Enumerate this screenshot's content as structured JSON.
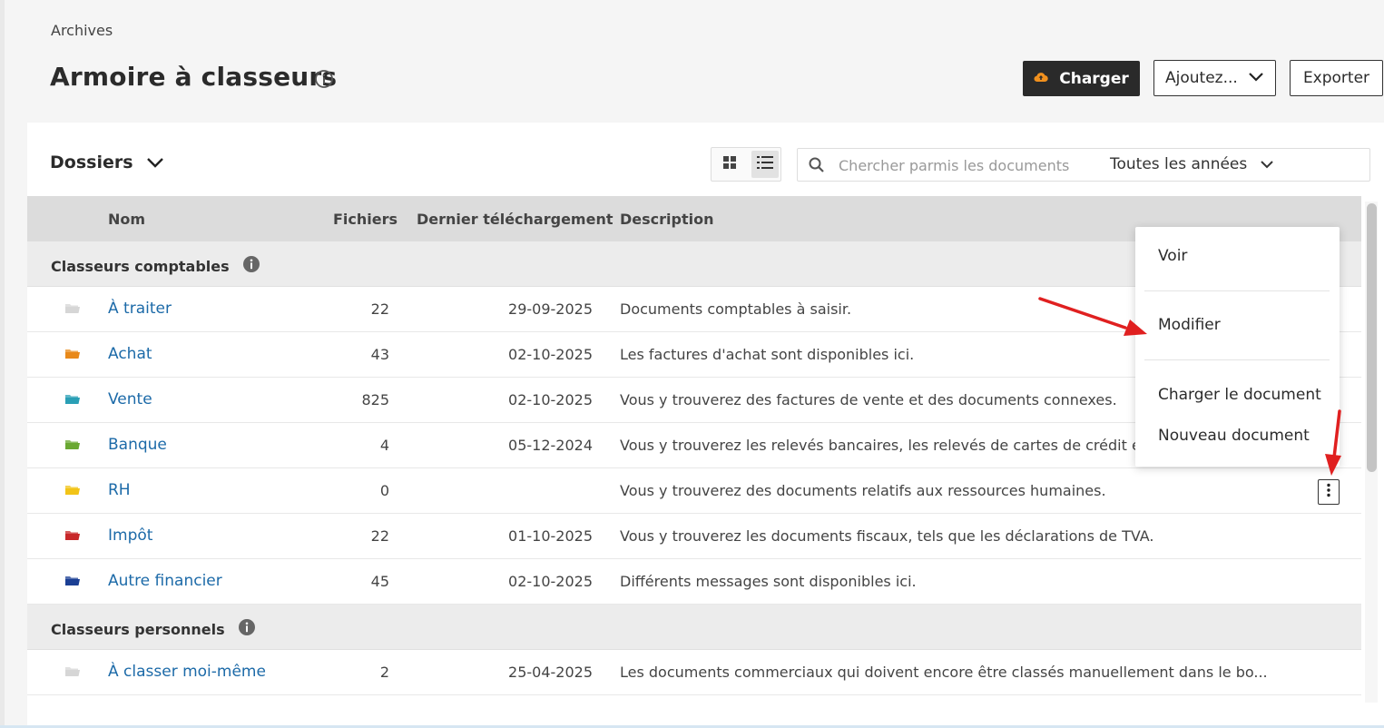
{
  "breadcrumb": "Archives",
  "page_title": "Armoire à classeurs",
  "actions": {
    "upload_label": "Charger",
    "add_label": "Ajoutez...",
    "export_label": "Exporter"
  },
  "section": {
    "dossiers_label": "Dossiers"
  },
  "search": {
    "placeholder": "Chercher parmis les documents",
    "year_filter": "Toutes les années"
  },
  "table": {
    "columns": [
      "Nom",
      "Fichiers",
      "Dernier téléchargement",
      "Description"
    ],
    "groups": [
      {
        "label": "Classeurs comptables",
        "rows": [
          {
            "name": "À traiter",
            "files": "22",
            "date": "29-09-2025",
            "description": "Documents comptables à saisir.",
            "folder_color": "#d6d6d6"
          },
          {
            "name": "Achat",
            "files": "43",
            "date": "02-10-2025",
            "description": "Les factures d'achat sont disponibles ici.",
            "folder_color": "#e8891a"
          },
          {
            "name": "Vente",
            "files": "825",
            "date": "02-10-2025",
            "description": "Vous y trouverez des factures de vente et des documents connexes.",
            "folder_color": "#2a9fb5"
          },
          {
            "name": "Banque",
            "files": "4",
            "date": "05-12-2024",
            "description": "Vous y trouverez les relevés bancaires, les relevés de cartes de crédit et l",
            "folder_color": "#6aa832"
          },
          {
            "name": "RH",
            "files": "0",
            "date": "",
            "description": "Vous y trouverez des documents relatifs aux ressources humaines.",
            "folder_color": "#f2c418"
          },
          {
            "name": "Impôt",
            "files": "22",
            "date": "01-10-2025",
            "description": "Vous y trouverez les documents fiscaux, tels que les déclarations de TVA.",
            "folder_color": "#c8282a"
          },
          {
            "name": "Autre financier",
            "files": "45",
            "date": "02-10-2025",
            "description": "Différents messages sont disponibles ici.",
            "folder_color": "#1b3f94"
          }
        ]
      },
      {
        "label": "Classeurs personnels",
        "rows": [
          {
            "name": "À classer moi-même",
            "files": "2",
            "date": "25-04-2025",
            "description": "Les documents commerciaux qui doivent encore être classés manuellement dans le bo...",
            "folder_color": "#d6d6d6"
          }
        ]
      }
    ]
  },
  "context_menu": {
    "items": [
      "Voir",
      "Modifier",
      "Charger le document",
      "Nouveau document"
    ]
  },
  "colors": {
    "accent_dark": "#2a2a2a",
    "link_blue": "#1c6aa8",
    "upload_icon_orange": "#f0901e",
    "annotation_arrow_red": "#e02020"
  }
}
